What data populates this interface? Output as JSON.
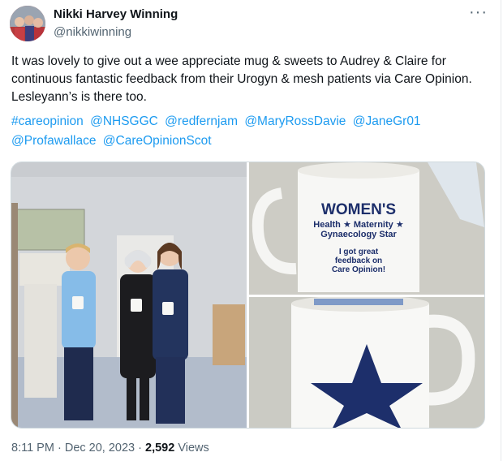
{
  "author": {
    "name": "Nikki Harvey Winning",
    "handle": "@nikkiwinning"
  },
  "menu_icon": "more-horizontal-icon",
  "text": "It was lovely to give out a wee appreciate mug & sweets to Audrey & Claire for continuous fantastic feedback from their Urogyn & mesh patients via Care Opinion. Lesleyann’s is there too.",
  "tags": [
    "#careopinion",
    "@NHSGGC",
    "@redfernjam",
    "@MaryRossDavie",
    "@JaneGr01",
    "@Profawallace",
    "@CareOpinionScot"
  ],
  "mug_text": {
    "line1": "WOMEN'S",
    "line2": "Health ★ Maternity ★",
    "line3": "Gynaecology Star",
    "line4": "I got great",
    "line5": "feedback on",
    "line6": "Care Opinion!"
  },
  "meta": {
    "time": "8:11 PM",
    "date": "Dec 20, 2023",
    "views_count": "2,592",
    "views_label": "Views"
  },
  "colors": {
    "link": "#1d9bf0",
    "secondary_text": "#536471",
    "scrub_blue": "#7fb3e3",
    "star_navy": "#1d2f6b"
  }
}
